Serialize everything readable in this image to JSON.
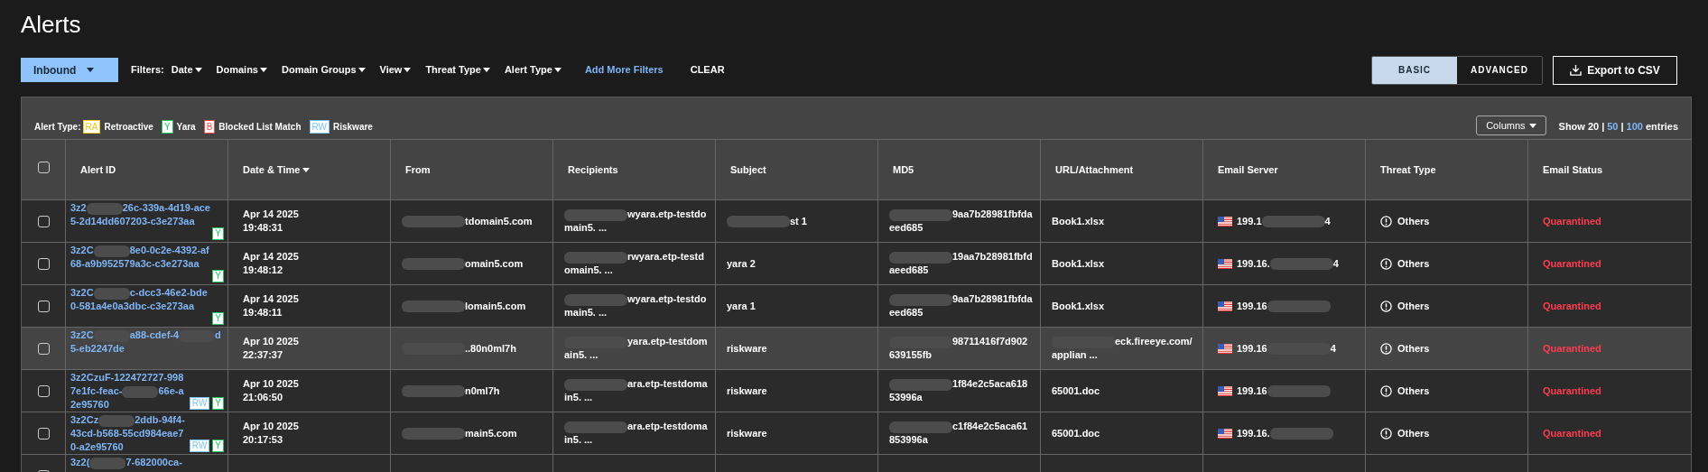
{
  "title": "Alerts",
  "toolbar": {
    "direction": {
      "label": "Inbound"
    },
    "filters_label": "Filters:",
    "filters": [
      "Date",
      "Domains",
      "Domain Groups",
      "View",
      "Threat Type",
      "Alert Type"
    ],
    "add_filters": "Add More Filters",
    "clear": "CLEAR",
    "view_modes": [
      {
        "label": "BASIC",
        "selected": true
      },
      {
        "label": "ADVANCED",
        "selected": false
      }
    ],
    "export": "Export to CSV"
  },
  "legend": {
    "label": "Alert Type:",
    "items": [
      {
        "badge": "RA",
        "label": "Retroactive",
        "color": "#f5c518"
      },
      {
        "badge": "Y",
        "label": "Yara",
        "color": "#22c55e"
      },
      {
        "badge": "B",
        "label": "Blocked List Match",
        "color": "#ef4444"
      },
      {
        "badge": "RW",
        "label": "Riskware",
        "color": "#7cc4f5"
      }
    ]
  },
  "columns_button": "Columns",
  "page_size": {
    "prefix": "Show",
    "options": [
      {
        "label": "20",
        "selected": true
      },
      {
        "label": "50",
        "selected": false
      },
      {
        "label": "100",
        "selected": false
      }
    ],
    "separators": [
      "|",
      "|"
    ],
    "suffix": "entries"
  },
  "table": {
    "select_all": {
      "checked": false
    },
    "columns": [
      {
        "label": "Alert ID",
        "sorted": false
      },
      {
        "label": "Date & Time",
        "sorted": true
      },
      {
        "label": "From",
        "sorted": false
      },
      {
        "label": "Recipients",
        "sorted": false
      },
      {
        "label": "Subject",
        "sorted": false
      },
      {
        "label": "MD5",
        "sorted": false
      },
      {
        "label": "URL/Attachment",
        "sorted": false
      },
      {
        "label": "Email Server",
        "sorted": false
      },
      {
        "label": "Threat Type",
        "sorted": false
      },
      {
        "label": "Email Status",
        "sorted": false
      }
    ],
    "rows": [
      {
        "checked": false,
        "highlighted": false,
        "alert_id": [
          "3z2",
          {
            "kind": "redaction"
          },
          "26c-339a-4d19-ace5-2d14dd607203-c3e273aa"
        ],
        "badges": [
          {
            "label": "Y",
            "color": "#22c55e"
          }
        ],
        "date": "Apr 14 2025",
        "time": "19:48:31",
        "from": [
          {
            "kind": "redaction"
          },
          "tdomain5.com"
        ],
        "recipients": [
          {
            "kind": "redaction"
          },
          "wyara.etp-testdomain5. ..."
        ],
        "subject": [
          {
            "kind": "redaction"
          },
          "st 1"
        ],
        "md5": [
          {
            "kind": "redaction"
          },
          "9aa7b28981fbfdaeed685"
        ],
        "url": [
          "Book1.xlsx"
        ],
        "server": [
          "199.1",
          {
            "kind": "redaction"
          },
          "4"
        ],
        "threat": "Others",
        "status": "Quarantined"
      },
      {
        "checked": false,
        "highlighted": false,
        "alert_id": [
          "3z2C",
          {
            "kind": "redaction"
          },
          "8e0-0c2e-4392-af68-a9b952579a3c-c3e273aa"
        ],
        "badges": [
          {
            "label": "Y",
            "color": "#22c55e"
          }
        ],
        "date": "Apr 14 2025",
        "time": "19:48:12",
        "from": [
          {
            "kind": "redaction"
          },
          "omain5.com"
        ],
        "recipients": [
          {
            "kind": "redaction"
          },
          "rwyara.etp-testdomain5. ..."
        ],
        "subject": [
          "yara 2"
        ],
        "md5": [
          {
            "kind": "redaction"
          },
          "19aa7b28981fbfdaeed685"
        ],
        "url": [
          "Book1.xlsx"
        ],
        "server": [
          "199.16.",
          {
            "kind": "redaction"
          },
          "4"
        ],
        "threat": "Others",
        "status": "Quarantined"
      },
      {
        "checked": false,
        "highlighted": false,
        "alert_id": [
          "3z2C",
          {
            "kind": "redaction"
          },
          "c-dcc3-46e2-bde0-581a4e0a3dbc-c3e273aa"
        ],
        "badges": [
          {
            "label": "Y",
            "color": "#22c55e"
          }
        ],
        "date": "Apr 14 2025",
        "time": "19:48:11",
        "from": [
          {
            "kind": "redaction"
          },
          "lomain5.com"
        ],
        "recipients": [
          {
            "kind": "redaction"
          },
          "wyara.etp-testdomain5. ..."
        ],
        "subject": [
          "yara 1"
        ],
        "md5": [
          {
            "kind": "redaction"
          },
          "9aa7b28981fbfdaeed685"
        ],
        "url": [
          "Book1.xlsx"
        ],
        "server": [
          "199.16",
          {
            "kind": "redaction"
          }
        ],
        "threat": "Others",
        "status": "Quarantined"
      },
      {
        "checked": false,
        "highlighted": true,
        "alert_id": [
          "3z2C",
          {
            "kind": "redaction"
          },
          "a88-cdef-4",
          {
            "kind": "redaction"
          },
          "d5-eb2247de"
        ],
        "badges": [],
        "date": "Apr 10 2025",
        "time": "22:37:37",
        "from": [
          {
            "kind": "redaction"
          },
          "..80n0ml7h"
        ],
        "recipients": [
          {
            "kind": "redaction"
          },
          "yara.etp-testdomain5. ..."
        ],
        "subject": [
          "riskware"
        ],
        "md5": [
          {
            "kind": "redaction"
          },
          "98711416f7d902639155fb"
        ],
        "url": [
          {
            "kind": "redaction"
          },
          "eck.fireeye.com/applian ..."
        ],
        "server": [
          "199.16",
          {
            "kind": "redaction"
          },
          "4"
        ],
        "threat": "Others",
        "status": "Quarantined"
      },
      {
        "checked": false,
        "highlighted": false,
        "alert_id": [
          "3z2CzuF-122472727-9987e1fc-feac-",
          {
            "kind": "redaction"
          },
          "66e-a2e95760"
        ],
        "badges": [
          {
            "label": "RW",
            "color": "#7cc4f5"
          },
          {
            "label": "Y",
            "color": "#22c55e"
          }
        ],
        "date": "Apr 10 2025",
        "time": "21:06:50",
        "from": [
          {
            "kind": "redaction"
          },
          "n0ml7h"
        ],
        "recipients": [
          {
            "kind": "redaction"
          },
          "ara.etp-testdomain5. ..."
        ],
        "subject": [
          "riskware"
        ],
        "md5": [
          {
            "kind": "redaction"
          },
          "1f84e2c5aca61853996a"
        ],
        "url": [
          "65001.doc"
        ],
        "server": [
          "199.16",
          {
            "kind": "redaction"
          }
        ],
        "threat": "Others",
        "status": "Quarantined"
      },
      {
        "checked": false,
        "highlighted": false,
        "alert_id": [
          "3z2Cz",
          {
            "kind": "redaction"
          },
          "2ddb-94f4-43cd-b568-55cd984eae70-a2e95760"
        ],
        "badges": [
          {
            "label": "RW",
            "color": "#7cc4f5"
          },
          {
            "label": "Y",
            "color": "#22c55e"
          }
        ],
        "date": "Apr 10 2025",
        "time": "20:17:53",
        "from": [
          {
            "kind": "redaction"
          },
          "main5.com"
        ],
        "recipients": [
          {
            "kind": "redaction"
          },
          "ara.etp-testdomain5. ..."
        ],
        "subject": [
          "riskware"
        ],
        "md5": [
          {
            "kind": "redaction"
          },
          "c1f84e2c5aca61853996a"
        ],
        "url": [
          "65001.doc"
        ],
        "server": [
          "199.16.",
          {
            "kind": "redaction"
          }
        ],
        "threat": "Others",
        "status": "Quarantined"
      },
      {
        "checked": false,
        "highlighted": false,
        "alert_id": [
          "3z2(",
          {
            "kind": "redaction"
          },
          "7-682000ca-"
        ],
        "badges": []
      }
    ]
  }
}
